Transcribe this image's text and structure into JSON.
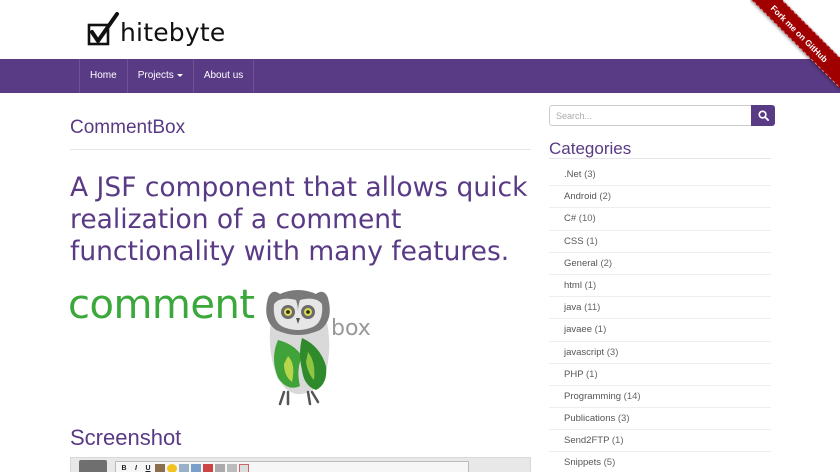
{
  "header": {
    "logo_text": "hitebyte",
    "ribbon": "Fork me on GitHub"
  },
  "nav": {
    "items": [
      {
        "label": "Home"
      },
      {
        "label": "Projects"
      },
      {
        "label": "About us"
      }
    ]
  },
  "main": {
    "title": "CommentBox",
    "lead": "A JSF component that allows quick realization of a comment functionality with many features.",
    "logo_word_comment": "comment",
    "logo_word_box": "box",
    "section_title": "Screenshot",
    "toolbar": {
      "bold": "B",
      "italic": "I",
      "underline": "U"
    }
  },
  "sidebar": {
    "search_placeholder": "Search...",
    "categories_title": "Categories",
    "categories": [
      {
        "label": ".Net",
        "count": "(3)"
      },
      {
        "label": "Android",
        "count": "(2)"
      },
      {
        "label": "C#",
        "count": "(10)"
      },
      {
        "label": "CSS",
        "count": "(1)"
      },
      {
        "label": "General",
        "count": "(2)"
      },
      {
        "label": "html",
        "count": "(1)"
      },
      {
        "label": "java",
        "count": "(11)"
      },
      {
        "label": "javaee",
        "count": "(1)"
      },
      {
        "label": "javascript",
        "count": "(3)"
      },
      {
        "label": "PHP",
        "count": "(1)"
      },
      {
        "label": "Programming",
        "count": "(14)"
      },
      {
        "label": "Publications",
        "count": "(3)"
      },
      {
        "label": "Send2FTP",
        "count": "(1)"
      },
      {
        "label": "Snippets",
        "count": "(5)"
      }
    ]
  },
  "colors": {
    "brand": "#593a85",
    "ribbon": "#a00000",
    "logo_green": "#3aa83a"
  },
  "icons": {
    "logo": "checkbox-check-icon",
    "search": "search-icon",
    "projects_dropdown": "caret-down-icon"
  }
}
